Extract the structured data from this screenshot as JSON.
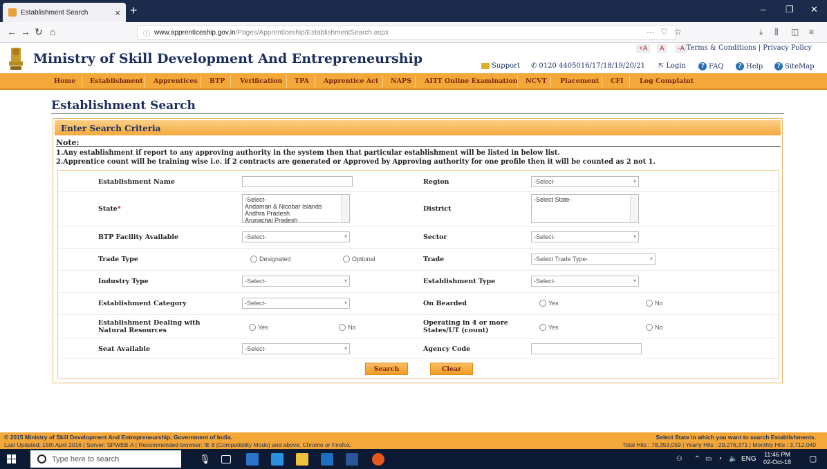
{
  "browser": {
    "tab_title": "Establishment Search",
    "url_host": "www.apprenticeship.gov.in",
    "url_path": "/Pages/Apprenticeship/EstablishmentSearch.aspx"
  },
  "header": {
    "site_title": "Ministry of Skill Development And Entrepreneurship",
    "font_plus": "+A",
    "font_normal": "A",
    "font_minus": "-A",
    "terms": "Terms & Conditions | Privacy Policy",
    "support": "Support",
    "phone": "0120 4405016/17/18/19/20/21",
    "login": "Login",
    "faq": "FAQ",
    "help": "Help",
    "sitemap": "SiteMap"
  },
  "menu": [
    "Home",
    "Establishment",
    "Apprentices",
    "BTP",
    "Verification",
    "TPA",
    "Apprentice Act",
    "NAPS",
    "AITT Online Examination",
    "NCVT",
    "Placement",
    "CFI",
    "Log Complaint"
  ],
  "page": {
    "heading": "Establishment Search",
    "panel_title": "Enter Search Criteria",
    "note_title": "Note:",
    "note_1": "1.Any establishment if report to any approving authority in the system then that particular establishment will be listed in below list.",
    "note_2": "2.Apprentice count will be training wise i.e. if 2 contracts are generated or Approved by Approving authority for one profile then it will be counted as 2 not 1."
  },
  "form": {
    "establishment_name_label": "Establishment Name",
    "region_label": "Region",
    "region_value": "-Select-",
    "state_label": "State",
    "state_required": "*",
    "state_options": [
      "-Select-",
      "Andaman & Nicobar Islands",
      "Andhra Pradesh",
      "Arunachal Pradesh"
    ],
    "district_label": "District",
    "district_value": "-Select State-",
    "btp_label": "BTP Facility Available",
    "btp_value": "-Select-",
    "sector_label": "Sector",
    "sector_value": "-Select-",
    "trade_type_label": "Trade Type",
    "trade_type_opt1": "Designated",
    "trade_type_opt2": "Optional",
    "trade_label": "Trade",
    "trade_value": "-Select Trade Type-",
    "industry_type_label": "Industry Type",
    "industry_type_value": "-Select-",
    "est_type_label": "Establishment Type",
    "est_type_value": "-Select-",
    "est_category_label": "Establishment Category",
    "est_category_value": "-Select-",
    "on_bearded_label": "On Bearded",
    "yes": "Yes",
    "no": "No",
    "natural_label": "Establishment Dealing with Natural Resources",
    "operating_label": "Operating in 4 or more States/UT (count)",
    "seat_label": "Seat Available",
    "seat_value": "-Select-",
    "agency_label": "Agency Code",
    "search_button": "Search",
    "clear_button": "Clear"
  },
  "footer": {
    "copyright": "© 2015 Ministry of Skill Development And Entrepreneurship, Government of India.",
    "updated": "Last Updated: 15th April 2016 | Server: SPWEB-A | Recommended browser: IE 8 (Compatibility Mode) and above, Chrome or Firefox.",
    "hint": "Select State in which you want to search Establishments.",
    "hits": "Total Hits : 78,353,059 | Yearly Hits : 29,276,371 | Monthly Hits : 3,712,040"
  },
  "taskbar": {
    "search_placeholder": "Type here to search",
    "lang": "ENG",
    "time": "11:46 PM",
    "date": "02-Oct-18"
  },
  "colors": {
    "menu_orange": "#f5a83a",
    "title_navy": "#1b2f5e",
    "taskbar": "#0d1a33"
  }
}
